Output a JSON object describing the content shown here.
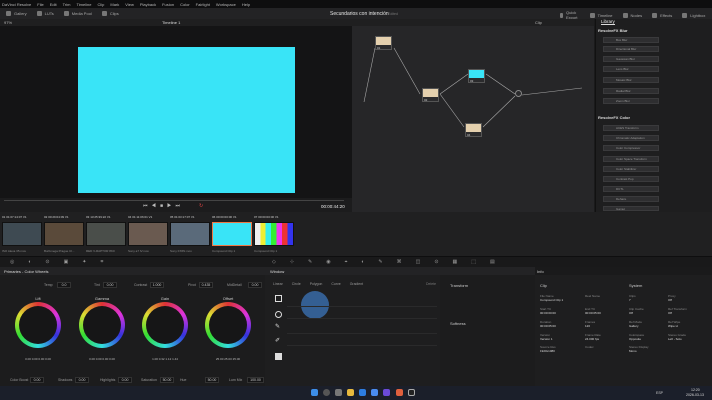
{
  "menu": [
    "DaVinci Resolve",
    "File",
    "Edit",
    "Trim",
    "Timeline",
    "Clip",
    "Mark",
    "View",
    "Playback",
    "Fusion",
    "Color",
    "Fairlight",
    "Workspace",
    "Help"
  ],
  "toolbar": {
    "left": [
      "Gallery",
      "LUTs",
      "Media Pool",
      "Clips"
    ],
    "project_title": "Secundarios con intención",
    "project_status": "Edited",
    "right": [
      "Quick Export",
      "Timeline",
      "Nodes",
      "Effects",
      "Lightbox"
    ]
  },
  "viewer": {
    "zoom": "97%",
    "timeline_name": "Timeline 1",
    "timecode": "00:00:44:20",
    "preview_color": "#39e4f7"
  },
  "nodes": {
    "header_right": "Clip",
    "items": [
      {
        "label": "01"
      },
      {
        "label": "02"
      },
      {
        "label": "03"
      },
      {
        "label": "04"
      }
    ]
  },
  "library": {
    "tab": "Library",
    "section1": "ResolveFX Blur",
    "blur_items": [
      "Box Blur",
      "Directional Blur",
      "Gaussian Blur",
      "Lens Blur",
      "Mosaic Blur",
      "Radial Blur",
      "Zoom Blur"
    ],
    "section2": "ResolveFX Color",
    "color_items": [
      "ACES Transform",
      "Chromatic Adaptation",
      "Color Compressor",
      "Color Space Transform",
      "Color Stabilizer",
      "Contrast Pop",
      "DCTL",
      "Dehaze",
      "Gamut"
    ]
  },
  "clips": [
    {
      "num": "01",
      "tc": "01:07:14:07",
      "track": "V1",
      "label": "ISO Alexa 35.mov"
    },
    {
      "num": "02",
      "tc": "00:29:04:09",
      "track": "V1",
      "label": "Burbmega Prague Cl..."
    },
    {
      "num": "03",
      "tc": "13:25:39:22",
      "track": "V1",
      "label": "RED V-RAPTOR 8K0"
    },
    {
      "num": "04",
      "tc": "01:11:06:01",
      "track": "V1",
      "label": "Sony a7 IV.mov"
    },
    {
      "num": "05",
      "tc": "01:03:17:07",
      "track": "V1",
      "label": "Sony FX6N.mov"
    },
    {
      "num": "06",
      "tc": "00:00:00:00",
      "track": "V1",
      "label": "Compound Clip 1"
    },
    {
      "num": "07",
      "tc": "00:00:00:00",
      "track": "V1",
      "label": "Compound Clip 1"
    }
  ],
  "color_wheels": {
    "title": "Primaries - Color Wheels",
    "params_top": {
      "Temp": "0.0",
      "Tint": "0.00",
      "Contrast": "1.000",
      "Pivot": "0.435",
      "MidDetail": "0.00"
    },
    "wheels": [
      {
        "name": "Lift",
        "vals": "0.00  0.00  0.00  0.00"
      },
      {
        "name": "Gamma",
        "vals": "0.00  0.00  0.00  0.00"
      },
      {
        "name": "Gain",
        "vals": "1.00  0.32  1.12  1.44"
      },
      {
        "name": "Offset",
        "vals": "25.00  25.00  25.00"
      }
    ],
    "params_bottom": {
      "Color Boost": "0.00",
      "Shadows": "0.00",
      "Highlights": "0.00",
      "Saturation": "50.00",
      "Hue": "50.00",
      "Lum Mix": "100.00"
    }
  },
  "window": {
    "title": "Window",
    "tools": [
      "Linear",
      "Circle",
      "Polygon",
      "Curve",
      "Gradient"
    ],
    "delete": "Delete"
  },
  "transform": {
    "title": "Transform",
    "softness": "Softness"
  },
  "info": {
    "title": "Info",
    "clip_section": "Clip",
    "system_section": "System",
    "fields": [
      {
        "label": "File Name",
        "value": "Compound Clip 1"
      },
      {
        "label": "Reel Name",
        "value": ""
      },
      {
        "label": "Start TC",
        "value": "00:00:00:00"
      },
      {
        "label": "End TC",
        "value": "00:00:05:00"
      },
      {
        "label": "Duration",
        "value": "00:00:05:00"
      },
      {
        "label": "Frames",
        "value": "120"
      },
      {
        "label": "Version",
        "value": "Version 1"
      },
      {
        "label": "Frame Rate",
        "value": "24.000 fps"
      },
      {
        "label": "Source Res",
        "value": "1920x1080"
      },
      {
        "label": "Codec",
        "value": ""
      }
    ],
    "system": [
      {
        "label": "Clips",
        "value": "7"
      },
      {
        "label": "Proxy",
        "value": "Off"
      },
      {
        "label": "Clip Cache",
        "value": "Off"
      },
      {
        "label": "Ref Transform",
        "value": "Off"
      },
      {
        "label": "Ref Mode",
        "value": "Gallery"
      },
      {
        "label": "Ref Wipe",
        "value": "Wipe H"
      },
      {
        "label": "Colorspace",
        "value": "Opposite"
      },
      {
        "label": "Stereo Grade",
        "value": "Left - Solo"
      },
      {
        "label": "Stereo Display",
        "value": "Mono"
      }
    ]
  },
  "taskbar": {
    "time": "12:20",
    "date": "2026-03-13",
    "lang": "ESP"
  }
}
